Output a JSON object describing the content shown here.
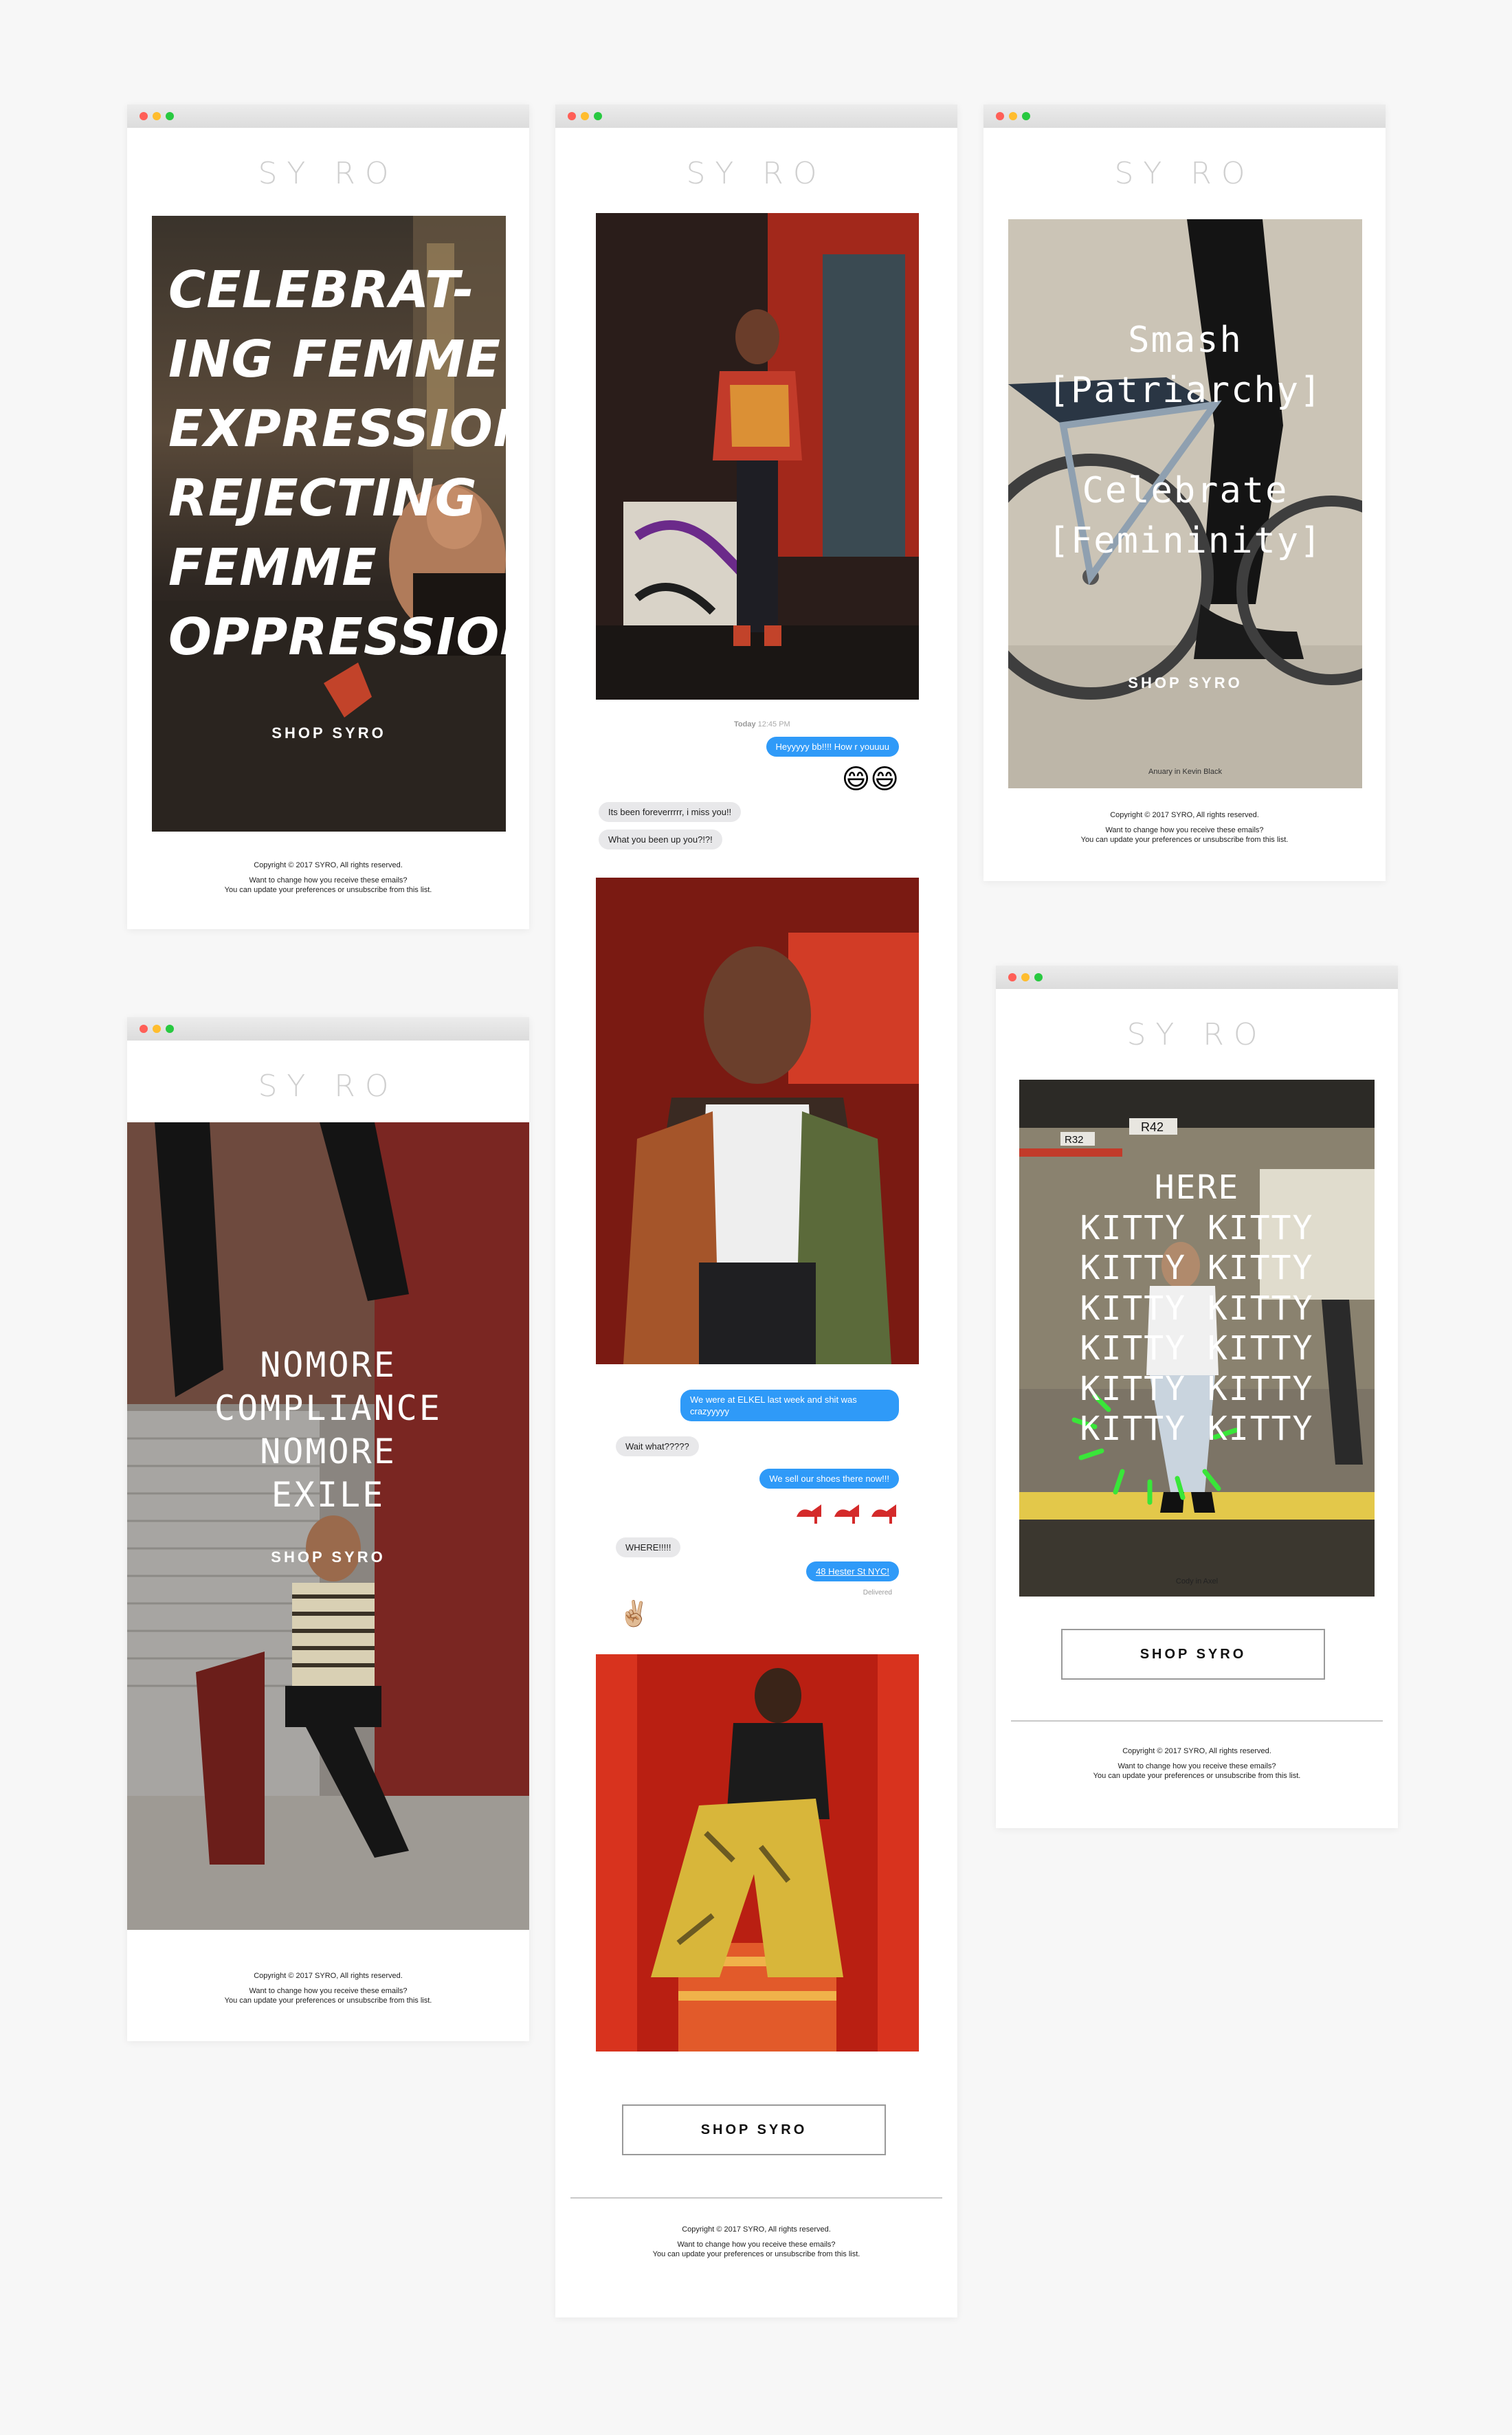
{
  "brand": {
    "logo": "SY RO"
  },
  "common": {
    "shop_label": "SHOP SYRO",
    "copyright": "Copyright © 2017 SYRO, All rights reserved.",
    "prefs_line1": "Want to change how you receive these emails?",
    "prefs_line2": "You can update your preferences or unsubscribe from this list."
  },
  "email1": {
    "headline_lines": [
      "CELEBRAT-",
      "ING FEMME",
      "EXPRESSION",
      "REJECTING",
      "FEMME",
      "OPPRESSION"
    ]
  },
  "email2": {
    "timestamp_day": "Today",
    "timestamp_time": "12:45 PM",
    "chat1": [
      {
        "from": "me",
        "text": "Heyyyyy bb!!!! How r youuuu"
      },
      {
        "from": "me",
        "text": "😄😄"
      },
      {
        "from": "them",
        "text": "Its been foreverrrrr, i miss you!!"
      },
      {
        "from": "them",
        "text": "What you been up you?!?!"
      }
    ],
    "chat2": [
      {
        "from": "me",
        "text": "We were at ELKEL last week and shit was crazyyyyy"
      },
      {
        "from": "them",
        "text": "Wait what?????"
      },
      {
        "from": "me",
        "text": "We sell our shoes there now!!!"
      },
      {
        "from": "me",
        "text": "👠👠👠"
      },
      {
        "from": "them",
        "text": "WHERE!!!!!"
      },
      {
        "from": "me",
        "text": "48 Hester St NYC!"
      },
      {
        "from": "them",
        "text": "✌🏼"
      }
    ],
    "delivered": "Delivered"
  },
  "email3": {
    "lines": [
      "Smash",
      "[Patriarchy]",
      "",
      "Celebrate",
      "[Femininity]"
    ],
    "credit": "Anuary in Kevin Black"
  },
  "email4": {
    "lines": [
      "NOMORE",
      "COMPLIANCE",
      "NOMORE",
      "EXILE"
    ]
  },
  "email5": {
    "lines": [
      "HERE",
      "KITTY KITTY",
      "KITTY KITTY",
      "KITTY KITTY",
      "KITTY KITTY",
      "KITTY KITTY",
      "KITTY KITTY"
    ],
    "sign_r42": "R42",
    "sign_r32": "R32",
    "credit": "Cody in Axel",
    "accent": "#39e639"
  }
}
